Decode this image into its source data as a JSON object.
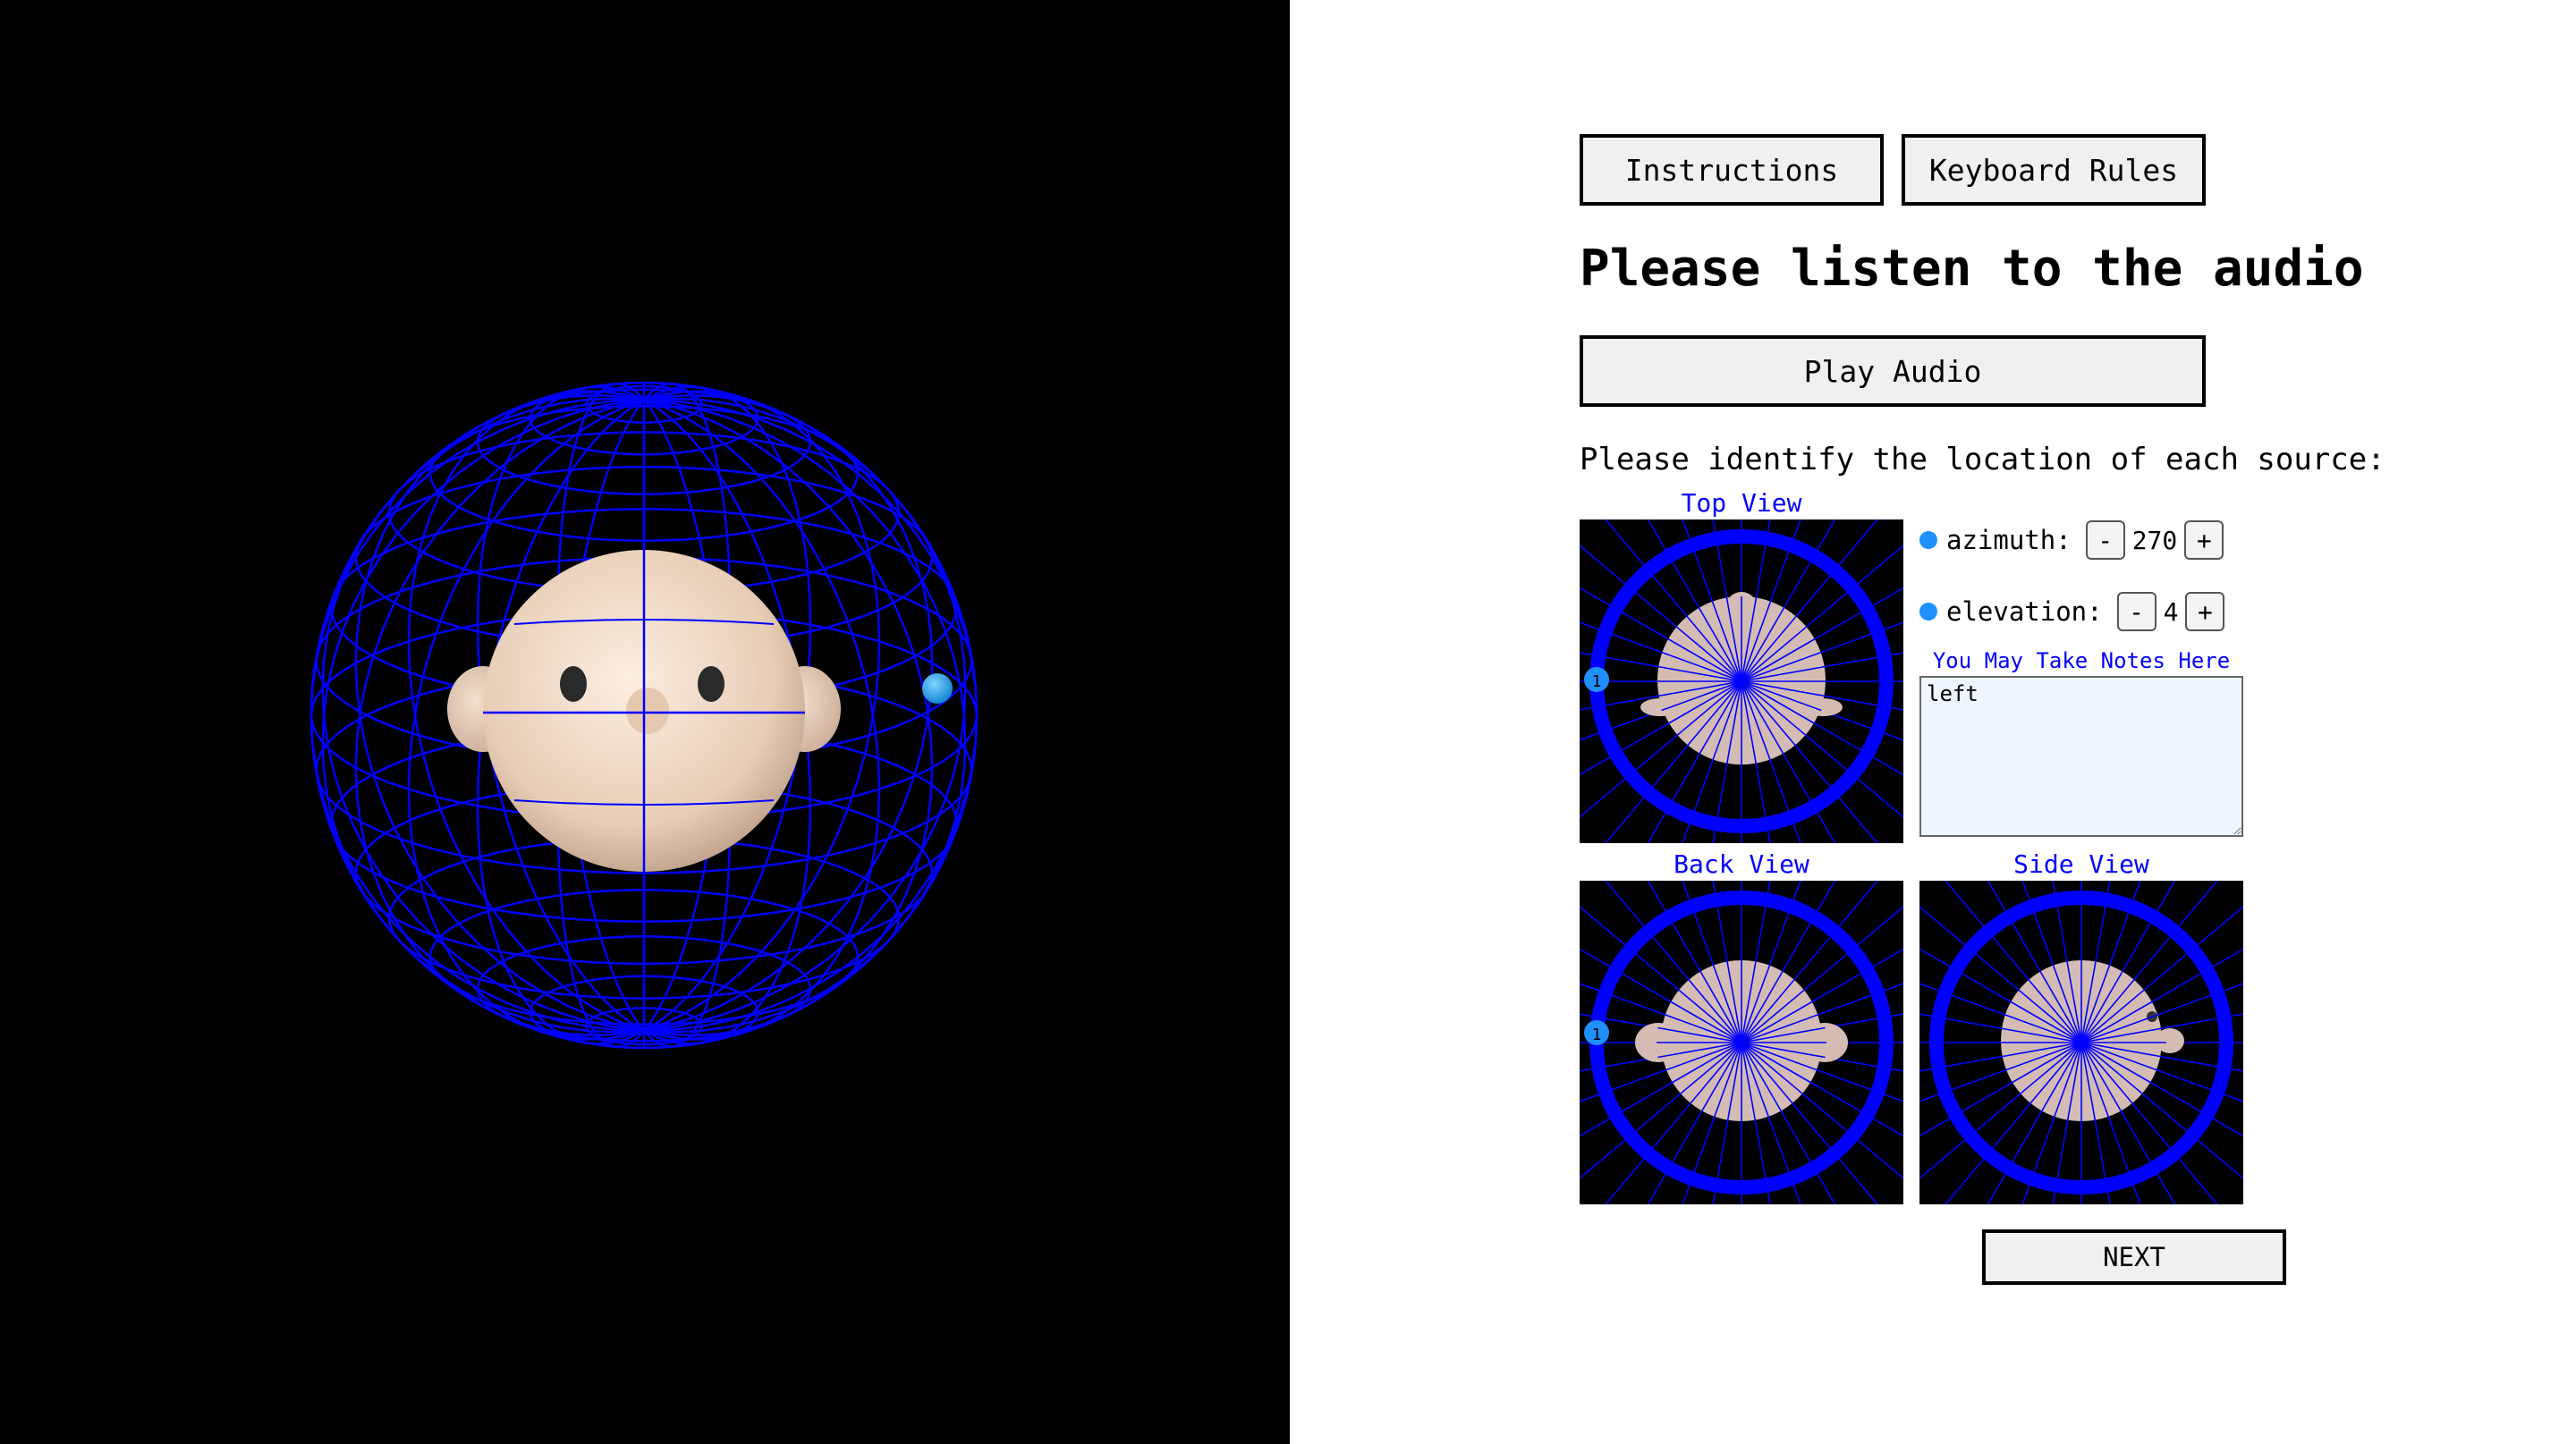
{
  "top_buttons": {
    "instructions": "Instructions",
    "keyboard_rules": "Keyboard Rules"
  },
  "heading": "Please listen to the audio",
  "play_button": "Play Audio",
  "prompt": "Please identify the location of each source:",
  "views": {
    "top": "Top View",
    "back": "Back View",
    "side": "Side View"
  },
  "source": {
    "marker_label": "1",
    "color": "#1e90ff"
  },
  "controls": {
    "azimuth_label": "azimuth:",
    "azimuth_value": "270",
    "elevation_label": "elevation:",
    "elevation_value": "4",
    "minus": "-",
    "plus": "+"
  },
  "notes": {
    "label": "You May Take Notes Here",
    "value": "left"
  },
  "next_button": "NEXT",
  "colors": {
    "wireframe": "#0000ff",
    "head": "#f1dbc7",
    "background_scene": "#000000",
    "accent": "#0000ff"
  }
}
